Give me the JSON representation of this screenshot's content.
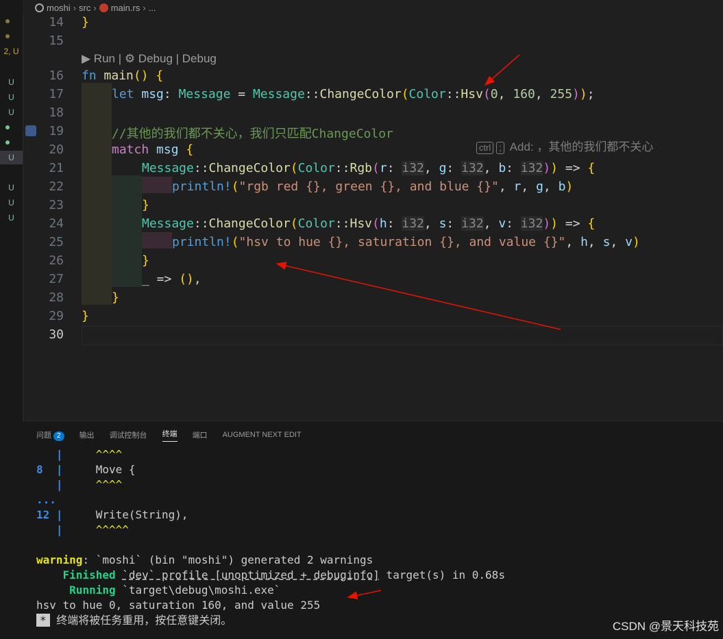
{
  "breadcrumb": {
    "items": [
      "moshi",
      "src",
      "main.rs",
      "..."
    ]
  },
  "gutter": {
    "marks": [
      "2, U",
      "U",
      "U",
      "U",
      "U",
      "U",
      "U",
      "U"
    ]
  },
  "codelens": "▶ Run | ⚙ Debug | Debug",
  "lines": [
    {
      "n": "14",
      "text": "}"
    },
    {
      "n": "15",
      "text": ""
    },
    {
      "n": "16",
      "text": "fn main() {"
    },
    {
      "n": "17",
      "text": "let msg: Message = Message::ChangeColor(Color::Hsv(0, 160, 255));"
    },
    {
      "n": "18",
      "text": ""
    },
    {
      "n": "19",
      "text": "//其他的我们都不关心，我们只匹配ChangeColor"
    },
    {
      "n": "20",
      "text": "match msg {"
    },
    {
      "n": "21",
      "text": "Message::ChangeColor(Color::Rgb(r: i32, g: i32, b: i32)) => {"
    },
    {
      "n": "22",
      "text": "println!(\"rgb red {}, green {}, and blue {}\", r, g, b)"
    },
    {
      "n": "23",
      "text": "}"
    },
    {
      "n": "24",
      "text": "Message::ChangeColor(Color::Hsv(h: i32, s: i32, v: i32)) => {"
    },
    {
      "n": "25",
      "text": "println!(\"hsv to hue {}, saturation {}, and value {}\", h, s, v)"
    },
    {
      "n": "26",
      "text": "}"
    },
    {
      "n": "27",
      "text": "_ => (),"
    },
    {
      "n": "28",
      "text": "}"
    },
    {
      "n": "29",
      "text": "}"
    },
    {
      "n": "30",
      "text": ""
    }
  ],
  "ghost": {
    "kbd1": "ctrl",
    "kbd2": ";",
    "text": "Add: ，其他的我们都不关心"
  },
  "panel": {
    "tabs": [
      "问题",
      "输出",
      "调试控制台",
      "终端",
      "端口",
      "AUGMENT NEXT EDIT"
    ],
    "problems_count": "2",
    "active_tab": "终端"
  },
  "terminal": {
    "l1_caret": "^^^^",
    "l2_num": "8",
    "l2_text": "Move {",
    "l3_caret": "^^^^",
    "l4": "...",
    "l5_num": "12",
    "l5_text": "Write(String),",
    "l6_caret": "^^^^^",
    "warning_label": "warning",
    "warning_text": ": `moshi` (bin \"moshi\") generated 2 warnings",
    "finished_label": "Finished",
    "finished_text1": "`dev` profile [unoptimized + debuginfo]",
    "finished_text2": " target(s) in 0.68s",
    "running_label": "Running",
    "running_text": "`target\\debug\\moshi.exe`",
    "output": "hsv to hue 0, saturation 160, and value 255",
    "cursor": "*",
    "close_msg": "终端将被任务重用，按任意键关闭。"
  },
  "watermark": "CSDN @景天科技苑",
  "colors": {
    "keyword": "#569cd6",
    "type": "#4ec9b0",
    "function": "#dcdcaa",
    "arrow": "#e51400"
  }
}
